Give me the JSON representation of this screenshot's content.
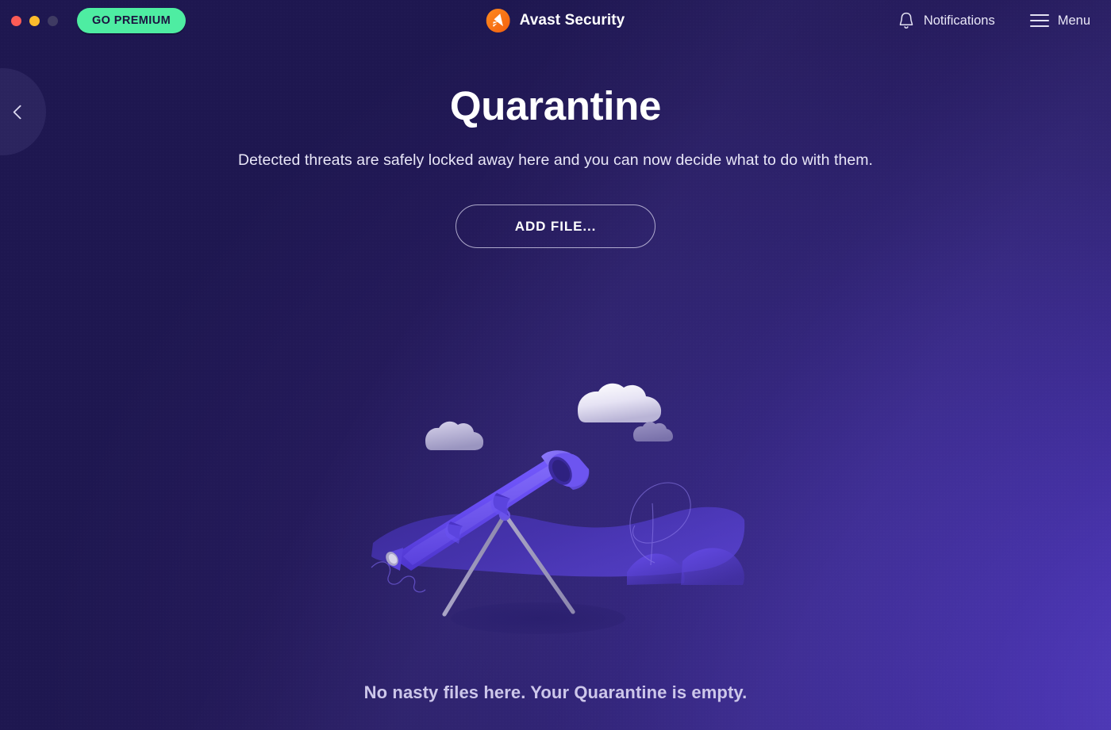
{
  "window": {
    "traffic_lights": [
      {
        "name": "close",
        "color": "#fc5b56"
      },
      {
        "name": "minimize",
        "color": "#fdbc2c"
      },
      {
        "name": "zoom",
        "color": "#3f3b63"
      }
    ]
  },
  "titlebar": {
    "go_premium_label": "GO PREMIUM",
    "brand_icon": "avast-logo-icon",
    "brand_name": "Avast Security",
    "notifications": {
      "icon": "bell-icon",
      "label": "Notifications"
    },
    "menu": {
      "icon": "hamburger-menu-icon",
      "label": "Menu"
    }
  },
  "navigation": {
    "back_icon": "chevron-left-icon",
    "back_label": ""
  },
  "main": {
    "title": "Quarantine",
    "subtitle": "Detected threats are safely locked away here and you can now decide what to do with them.",
    "add_file_label": "ADD FILE...",
    "empty_state_message": "No nasty files here. Your Quarantine is empty.",
    "illustration_name": "telescope-illustration"
  },
  "colors": {
    "accent_green": "#4eeda2",
    "brand_orange": "#f4751f",
    "background_dark": "#201a52",
    "background_light": "#5a45c8",
    "text_primary": "#ffffff",
    "text_muted": "#cdc7ea",
    "telescope_purple": "#5b3fe8",
    "tripod_grey": "#9d99bb"
  }
}
